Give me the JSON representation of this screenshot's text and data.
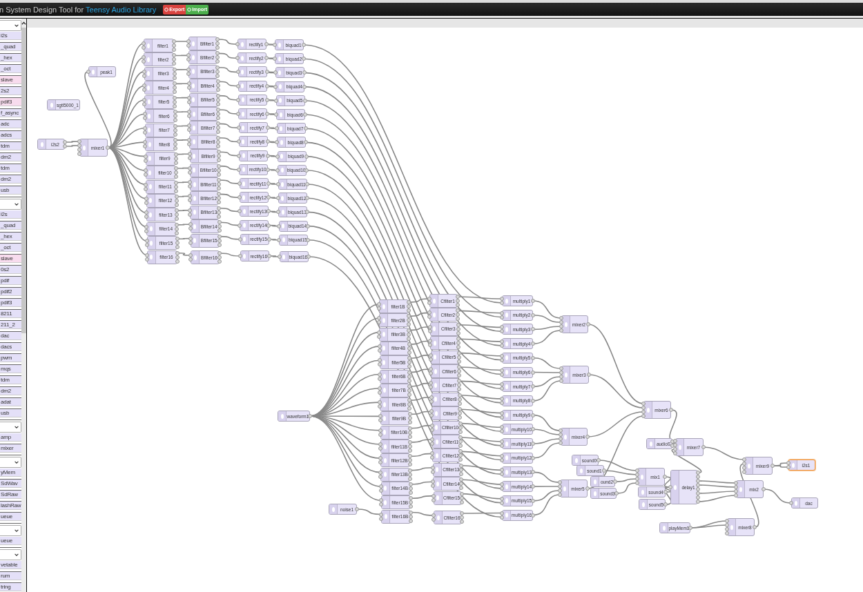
{
  "header": {
    "title": "n System Design Tool for",
    "library": "Teensy Audio Library",
    "buttons": [
      {
        "label": "Export",
        "kind": "export"
      },
      {
        "label": "Import",
        "kind": "import"
      }
    ]
  },
  "palette": [
    {
      "kind": "dropdown"
    },
    {
      "kind": "item",
      "label": "i2s",
      "color": "#e4e0f8"
    },
    {
      "kind": "item",
      "label": "_quad",
      "color": "#e4e0f8"
    },
    {
      "kind": "item",
      "label": "_hex",
      "color": "#e4e0f8"
    },
    {
      "kind": "item",
      "label": "_oct",
      "color": "#e4e0f8"
    },
    {
      "kind": "item",
      "label": "slave",
      "color": "#f8dcee"
    },
    {
      "kind": "item",
      "label": "2s2",
      "color": "#e4e0f8"
    },
    {
      "kind": "item",
      "label": "pdif3",
      "color": "#f8dcee"
    },
    {
      "kind": "item",
      "label": "f_async",
      "color": "#e4e0f8"
    },
    {
      "kind": "item",
      "label": "adc",
      "color": "#e4e0f8"
    },
    {
      "kind": "item",
      "label": "adcs",
      "color": "#e4e0f8"
    },
    {
      "kind": "item",
      "label": "tdm",
      "color": "#e4e0f8"
    },
    {
      "kind": "item",
      "label": "dm2",
      "color": "#e4e0f8"
    },
    {
      "kind": "item",
      "label": "tdm",
      "color": "#e4e0f8"
    },
    {
      "kind": "item",
      "label": "dm2",
      "color": "#e4e0f8"
    },
    {
      "kind": "item",
      "label": "usb",
      "color": "#e4e0f8"
    },
    {
      "kind": "dropdown"
    },
    {
      "kind": "item",
      "label": "i2s",
      "color": "#e4e0f8"
    },
    {
      "kind": "item",
      "label": "_quad",
      "color": "#e4e0f8"
    },
    {
      "kind": "item",
      "label": "_hex",
      "color": "#e4e0f8"
    },
    {
      "kind": "item",
      "label": "_oct",
      "color": "#e4e0f8"
    },
    {
      "kind": "item",
      "label": "slave",
      "color": "#f8dcee"
    },
    {
      "kind": "item",
      "label": "0s2",
      "color": "#e4e0f8"
    },
    {
      "kind": "item",
      "label": "pdif",
      "color": "#e4e0f8"
    },
    {
      "kind": "item",
      "label": "pdif2",
      "color": "#e4e0f8"
    },
    {
      "kind": "item",
      "label": "pdif3",
      "color": "#e4e0f8"
    },
    {
      "kind": "item",
      "label": "8211",
      "color": "#e4e0f8"
    },
    {
      "kind": "item",
      "label": "211_2",
      "color": "#e4e0f8"
    },
    {
      "kind": "item",
      "label": "dac",
      "color": "#e4e0f8"
    },
    {
      "kind": "item",
      "label": "dacs",
      "color": "#e4e0f8"
    },
    {
      "kind": "item",
      "label": "pwm",
      "color": "#e4e0f8"
    },
    {
      "kind": "item",
      "label": "mqs",
      "color": "#e4e0f8"
    },
    {
      "kind": "item",
      "label": "tdm",
      "color": "#e4e0f8"
    },
    {
      "kind": "item",
      "label": "dm2",
      "color": "#e4e0f8"
    },
    {
      "kind": "item",
      "label": "adat",
      "color": "#e4e0f8"
    },
    {
      "kind": "item",
      "label": "usb",
      "color": "#e4e0f8"
    },
    {
      "kind": "dropdown"
    },
    {
      "kind": "item",
      "label": "amp",
      "color": "#e4e0f8"
    },
    {
      "kind": "item",
      "label": "mixer",
      "color": "#e4e0f8"
    },
    {
      "kind": "dropdown"
    },
    {
      "kind": "item",
      "label": "yMem",
      "color": "#e4e0f8"
    },
    {
      "kind": "item",
      "label": "SdWav",
      "color": "#e4e0f8"
    },
    {
      "kind": "item",
      "label": "SdRaw",
      "color": "#e4e0f8"
    },
    {
      "kind": "item",
      "label": "lashRaw",
      "color": "#e4e0f8"
    },
    {
      "kind": "item",
      "label": "ueue",
      "color": "#e4e0f8"
    },
    {
      "kind": "dropdown"
    },
    {
      "kind": "item",
      "label": "ueue",
      "color": "#e4e0f8"
    },
    {
      "kind": "dropdown"
    },
    {
      "kind": "item",
      "label": "vetable",
      "color": "#e4e0f8"
    },
    {
      "kind": "item",
      "label": "rum",
      "color": "#e4e0f8"
    },
    {
      "kind": "item",
      "label": "tring",
      "color": "#e4e0f8"
    }
  ],
  "nodes": [
    {
      "label": "peak1",
      "kind": "analyze",
      "selected": false
    },
    {
      "label": "sgtl5000_1",
      "kind": "control",
      "selected": false
    },
    {
      "label": "i2s2",
      "kind": "input_stereo",
      "selected": false
    },
    {
      "label": "mixer1",
      "kind": "mixer",
      "selected": false
    },
    {
      "label": "filter1",
      "kind": "filter",
      "selected": false
    },
    {
      "label": "filter2",
      "kind": "filter",
      "selected": false
    },
    {
      "label": "filter3",
      "kind": "filter",
      "selected": false
    },
    {
      "label": "filter4",
      "kind": "filter",
      "selected": false
    },
    {
      "label": "filter5",
      "kind": "filter",
      "selected": false
    },
    {
      "label": "filter6",
      "kind": "filter",
      "selected": false
    },
    {
      "label": "filter7",
      "kind": "filter",
      "selected": false
    },
    {
      "label": "filter8",
      "kind": "filter",
      "selected": false
    },
    {
      "label": "filter9",
      "kind": "filter",
      "selected": false
    },
    {
      "label": "filter10",
      "kind": "filter",
      "selected": false
    },
    {
      "label": "filter11",
      "kind": "filter",
      "selected": false
    },
    {
      "label": "filter12",
      "kind": "filter",
      "selected": false
    },
    {
      "label": "filter13",
      "kind": "filter",
      "selected": false
    },
    {
      "label": "filter14",
      "kind": "filter",
      "selected": false
    },
    {
      "label": "filter15",
      "kind": "filter",
      "selected": false
    },
    {
      "label": "filter16",
      "kind": "filter",
      "selected": false
    },
    {
      "label": "Bfilter1",
      "kind": "filter",
      "selected": false
    },
    {
      "label": "Bfilter2",
      "kind": "filter",
      "selected": false
    },
    {
      "label": "Bfilter3",
      "kind": "filter",
      "selected": false
    },
    {
      "label": "Bfilter4",
      "kind": "filter",
      "selected": false
    },
    {
      "label": "Bfilter5",
      "kind": "filter",
      "selected": false
    },
    {
      "label": "Bfilter6",
      "kind": "filter",
      "selected": false
    },
    {
      "label": "Bfilter7",
      "kind": "filter",
      "selected": false
    },
    {
      "label": "Bfilter8",
      "kind": "filter",
      "selected": false
    },
    {
      "label": "Bfilter9",
      "kind": "filter",
      "selected": false
    },
    {
      "label": "Bfilter10",
      "kind": "filter",
      "selected": false
    },
    {
      "label": "Bfilter11",
      "kind": "filter",
      "selected": false
    },
    {
      "label": "Bfilter12",
      "kind": "filter",
      "selected": false
    },
    {
      "label": "Bfilter13",
      "kind": "filter",
      "selected": false
    },
    {
      "label": "Bfilter14",
      "kind": "filter",
      "selected": false
    },
    {
      "label": "Bfilter15",
      "kind": "filter",
      "selected": false
    },
    {
      "label": "Bfilter16",
      "kind": "filter",
      "selected": false
    },
    {
      "label": "rectify1",
      "kind": "effect",
      "selected": false
    },
    {
      "label": "rectify2",
      "kind": "effect",
      "selected": false
    },
    {
      "label": "rectify3",
      "kind": "effect",
      "selected": false
    },
    {
      "label": "rectify4",
      "kind": "effect",
      "selected": false
    },
    {
      "label": "rectify5",
      "kind": "effect",
      "selected": false
    },
    {
      "label": "rectify6",
      "kind": "effect",
      "selected": false
    },
    {
      "label": "rectify7",
      "kind": "effect",
      "selected": false
    },
    {
      "label": "rectify8",
      "kind": "effect",
      "selected": false
    },
    {
      "label": "rectify9",
      "kind": "effect",
      "selected": false
    },
    {
      "label": "rectify10",
      "kind": "effect",
      "selected": false
    },
    {
      "label": "rectify11",
      "kind": "effect",
      "selected": false
    },
    {
      "label": "rectify12",
      "kind": "effect",
      "selected": false
    },
    {
      "label": "rectify13",
      "kind": "effect",
      "selected": false
    },
    {
      "label": "rectify14",
      "kind": "effect",
      "selected": false
    },
    {
      "label": "rectify15",
      "kind": "effect",
      "selected": false
    },
    {
      "label": "rectify16",
      "kind": "effect",
      "selected": false
    },
    {
      "label": "biquad1",
      "kind": "effect",
      "selected": false
    },
    {
      "label": "biquad2",
      "kind": "effect",
      "selected": false
    },
    {
      "label": "biquad3",
      "kind": "effect",
      "selected": false
    },
    {
      "label": "biquad4",
      "kind": "effect",
      "selected": false
    },
    {
      "label": "biquad5",
      "kind": "effect",
      "selected": false
    },
    {
      "label": "biquad6",
      "kind": "effect",
      "selected": false
    },
    {
      "label": "biquad7",
      "kind": "effect",
      "selected": false
    },
    {
      "label": "biquad8",
      "kind": "effect",
      "selected": false
    },
    {
      "label": "biquad9",
      "kind": "effect",
      "selected": false
    },
    {
      "label": "biquad10",
      "kind": "effect",
      "selected": false
    },
    {
      "label": "biquad11",
      "kind": "effect",
      "selected": false
    },
    {
      "label": "biquad12",
      "kind": "effect",
      "selected": false
    },
    {
      "label": "biquad13",
      "kind": "effect",
      "selected": false
    },
    {
      "label": "biquad14",
      "kind": "effect",
      "selected": false
    },
    {
      "label": "biquad15",
      "kind": "effect",
      "selected": false
    },
    {
      "label": "biquad16",
      "kind": "effect",
      "selected": false
    },
    {
      "label": "waveform1",
      "kind": "synth",
      "selected": false
    },
    {
      "label": "noise1",
      "kind": "synth",
      "selected": false
    },
    {
      "label": "filter1B",
      "kind": "filter",
      "selected": false
    },
    {
      "label": "filter2B",
      "kind": "filter",
      "selected": false
    },
    {
      "label": "filter3B",
      "kind": "filter",
      "selected": false
    },
    {
      "label": "filter4B",
      "kind": "filter",
      "selected": false
    },
    {
      "label": "filter5B",
      "kind": "filter",
      "selected": false
    },
    {
      "label": "filter6B",
      "kind": "filter",
      "selected": false
    },
    {
      "label": "filter7B",
      "kind": "filter",
      "selected": false
    },
    {
      "label": "filter8B",
      "kind": "filter",
      "selected": false
    },
    {
      "label": "filter9B",
      "kind": "filter",
      "selected": false
    },
    {
      "label": "filter10B",
      "kind": "filter",
      "selected": false
    },
    {
      "label": "filter11B",
      "kind": "filter",
      "selected": false
    },
    {
      "label": "filter12B",
      "kind": "filter",
      "selected": false
    },
    {
      "label": "filter13B",
      "kind": "filter",
      "selected": false
    },
    {
      "label": "filter14B",
      "kind": "filter",
      "selected": false
    },
    {
      "label": "filter15B",
      "kind": "filter",
      "selected": false
    },
    {
      "label": "filter16B",
      "kind": "filter",
      "selected": false
    },
    {
      "label": "Cfilter1",
      "kind": "filter",
      "selected": false
    },
    {
      "label": "Cfilter2",
      "kind": "filter",
      "selected": false
    },
    {
      "label": "Cfilter3",
      "kind": "filter",
      "selected": false
    },
    {
      "label": "Cfilter4",
      "kind": "filter",
      "selected": false
    },
    {
      "label": "Cfilter5",
      "kind": "filter",
      "selected": false
    },
    {
      "label": "Cfilter6",
      "kind": "filter",
      "selected": false
    },
    {
      "label": "Cfilter7",
      "kind": "filter",
      "selected": false
    },
    {
      "label": "Cfilter8",
      "kind": "filter",
      "selected": false
    },
    {
      "label": "Cfilter9",
      "kind": "filter",
      "selected": false
    },
    {
      "label": "Cfilter10",
      "kind": "filter",
      "selected": false
    },
    {
      "label": "Cfilter11",
      "kind": "filter",
      "selected": false
    },
    {
      "label": "Cfilter12",
      "kind": "filter",
      "selected": false
    },
    {
      "label": "Cfilter13",
      "kind": "filter",
      "selected": false
    },
    {
      "label": "Cfilter14",
      "kind": "filter",
      "selected": false
    },
    {
      "label": "Cfilter15",
      "kind": "filter",
      "selected": false
    },
    {
      "label": "Cfilter16",
      "kind": "filter",
      "selected": false
    },
    {
      "label": "multiply1",
      "kind": "multiply",
      "selected": false
    },
    {
      "label": "multiply2",
      "kind": "multiply",
      "selected": false
    },
    {
      "label": "multiply3",
      "kind": "multiply",
      "selected": false
    },
    {
      "label": "multiply4",
      "kind": "multiply",
      "selected": false
    },
    {
      "label": "multiply5",
      "kind": "multiply",
      "selected": false
    },
    {
      "label": "multiply6",
      "kind": "multiply",
      "selected": false
    },
    {
      "label": "multiply7",
      "kind": "multiply",
      "selected": false
    },
    {
      "label": "multiply8",
      "kind": "multiply",
      "selected": false
    },
    {
      "label": "multiply9",
      "kind": "multiply",
      "selected": false
    },
    {
      "label": "multiply10",
      "kind": "multiply",
      "selected": false
    },
    {
      "label": "multiply11",
      "kind": "multiply",
      "selected": false
    },
    {
      "label": "multiply12",
      "kind": "multiply",
      "selected": false
    },
    {
      "label": "multiply13",
      "kind": "multiply",
      "selected": false
    },
    {
      "label": "multiply14",
      "kind": "multiply",
      "selected": false
    },
    {
      "label": "multiply15",
      "kind": "multiply",
      "selected": false
    },
    {
      "label": "multiply16",
      "kind": "multiply",
      "selected": false
    },
    {
      "label": "mixer2",
      "kind": "mixer",
      "selected": false
    },
    {
      "label": "mixer3",
      "kind": "mixer",
      "selected": false
    },
    {
      "label": "mixer4",
      "kind": "mixer",
      "selected": false
    },
    {
      "label": "mixer5",
      "kind": "mixer",
      "selected": false
    },
    {
      "label": "mixer6",
      "kind": "mixer",
      "selected": false
    },
    {
      "label": "audioS",
      "kind": "play_stereo",
      "selected": false
    },
    {
      "label": "mixer7",
      "kind": "mixer",
      "selected": false
    },
    {
      "label": "sound0",
      "kind": "synth",
      "selected": false
    },
    {
      "label": "sound1",
      "kind": "synth",
      "selected": false
    },
    {
      "label": "ound2",
      "kind": "synth",
      "selected": false
    },
    {
      "label": "sound3",
      "kind": "synth",
      "selected": false
    },
    {
      "label": "mix1",
      "kind": "mixer",
      "selected": false
    },
    {
      "label": "delay1",
      "kind": "delay",
      "selected": false
    },
    {
      "label": "sound4",
      "kind": "synth",
      "selected": false
    },
    {
      "label": "sound5",
      "kind": "synth",
      "selected": false
    },
    {
      "label": "mixer9",
      "kind": "mixer",
      "selected": false
    },
    {
      "label": "i2s1",
      "kind": "output_stereo",
      "selected": true
    },
    {
      "label": "mix2",
      "kind": "mixer",
      "selected": false
    },
    {
      "label": "dac",
      "kind": "output_mono",
      "selected": false
    },
    {
      "label": "playMem1",
      "kind": "synth",
      "selected": false
    },
    {
      "label": "mixer8",
      "kind": "mixer",
      "selected": false
    }
  ]
}
